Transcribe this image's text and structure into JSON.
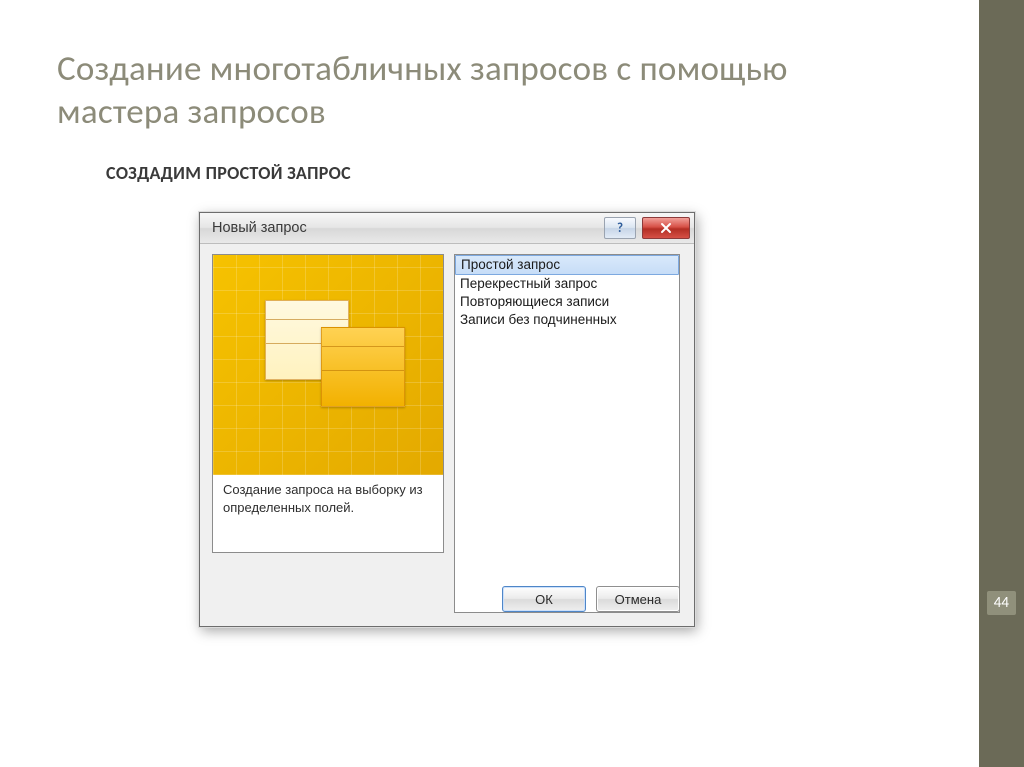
{
  "slide": {
    "title": "Создание многотабличных запросов с помощью мастера запросов",
    "subtitle": "СОЗДАДИМ ПРОСТОЙ ЗАПРОС",
    "page_number": "44"
  },
  "dialog": {
    "title": "Новый запрос",
    "preview_caption": "Создание запроса на выборку из определенных полей.",
    "list_items": [
      "Простой запрос",
      "Перекрестный запрос",
      "Повторяющиеся записи",
      "Записи без подчиненных"
    ],
    "selected_index": 0,
    "buttons": {
      "ok": "ОК",
      "cancel": "Отмена"
    }
  }
}
